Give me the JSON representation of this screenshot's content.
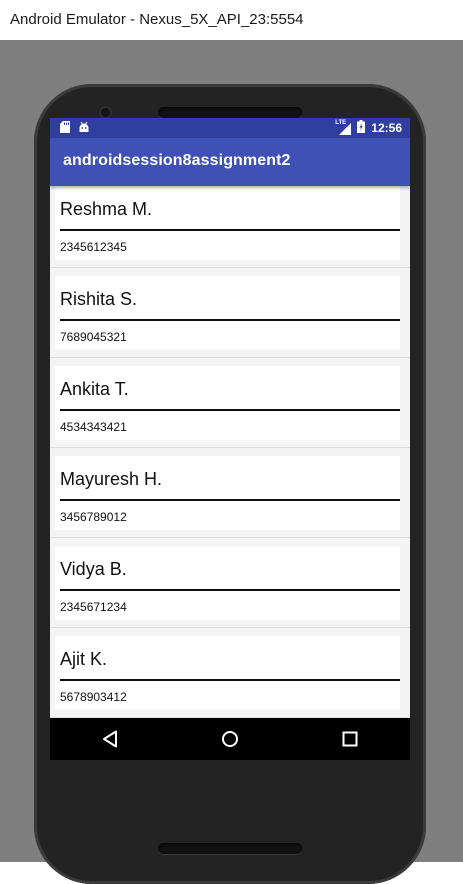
{
  "window": {
    "title": "Android Emulator - Nexus_5X_API_23:5554"
  },
  "status_bar": {
    "time": "12:56",
    "network_label": "LTE",
    "icons": [
      "sd-card-icon",
      "android-debug-icon",
      "signal-icon",
      "battery-icon"
    ]
  },
  "app_bar": {
    "title": "androidsession8assignment2"
  },
  "contacts": [
    {
      "name": "Reshma M.",
      "phone": "2345612345"
    },
    {
      "name": "Rishita S.",
      "phone": "7689045321"
    },
    {
      "name": "Ankita T.",
      "phone": "4534343421"
    },
    {
      "name": "Mayuresh H.",
      "phone": "3456789012"
    },
    {
      "name": "Vidya B.",
      "phone": "2345671234"
    },
    {
      "name": "Ajit K.",
      "phone": "5678903412"
    }
  ],
  "nav_bar": {
    "icons": [
      "back-icon",
      "home-icon",
      "recents-icon"
    ]
  },
  "colors": {
    "status_bar": "#303f9f",
    "app_bar": "#3f51b5",
    "list_background": "#f4f4f4",
    "divider": "#111111",
    "emulator_background": "#7f7f7f"
  }
}
